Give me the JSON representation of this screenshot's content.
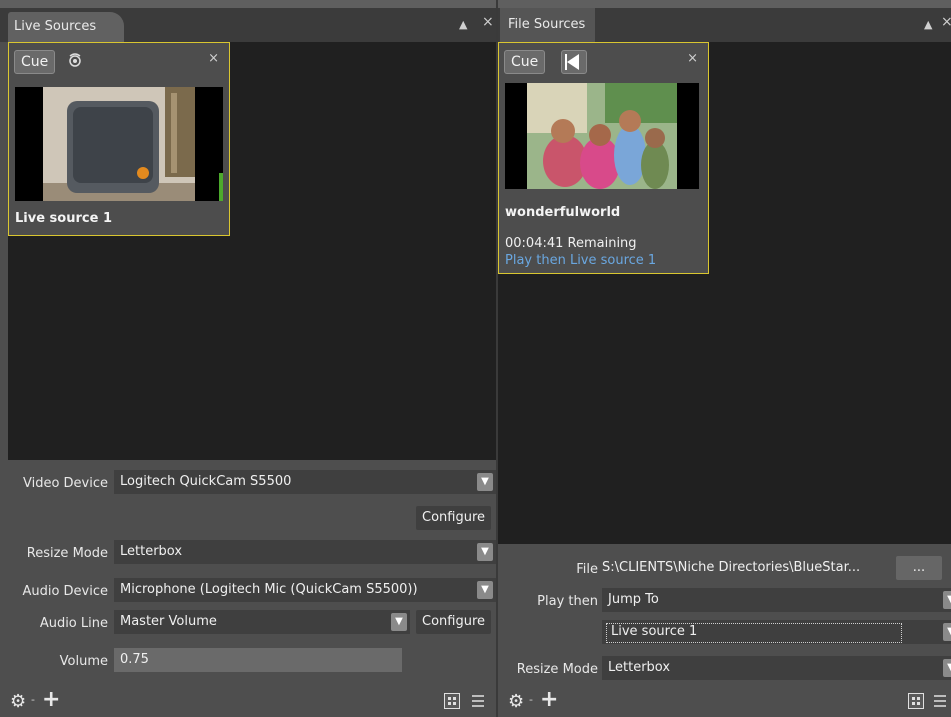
{
  "live_panel": {
    "tab_title": "Live Sources",
    "card": {
      "cue_label": "Cue",
      "close_glyph": "×",
      "title": "Live source 1"
    },
    "props": {
      "video_device": {
        "label": "Video Device",
        "value": "Logitech QuickCam S5500"
      },
      "configure_video_label": "Configure",
      "resize_mode": {
        "label": "Resize Mode",
        "value": "Letterbox"
      },
      "audio_device": {
        "label": "Audio Device",
        "value": "Microphone (Logitech Mic (QuickCam S5500))"
      },
      "audio_line": {
        "label": "Audio Line",
        "value": "Master Volume"
      },
      "configure_audio_label": "Configure",
      "volume": {
        "label": "Volume",
        "value": "0.75"
      }
    }
  },
  "file_panel": {
    "tab_title": "File Sources",
    "card": {
      "cue_label": "Cue",
      "close_glyph": "×",
      "title": "wonderfulworld",
      "remaining": "00:04:41 Remaining",
      "play_then_text": "Play then Live source 1"
    },
    "props": {
      "file": {
        "label": "File",
        "value": "S:\\CLIENTS\\Niche Directories\\BlueStar..."
      },
      "browse_label": "...",
      "play_then": {
        "label": "Play then",
        "value": "Jump To"
      },
      "target_value": "Live source 1",
      "resize_mode": {
        "label": "Resize Mode",
        "value": "Letterbox"
      }
    }
  },
  "icons": {
    "pin": "pin-icon",
    "close": "close-icon",
    "eye": "preview-icon",
    "gear": "gear-icon",
    "plus": "plus-icon",
    "grid_view": "grid-view-icon",
    "list_view": "list-view-icon",
    "dropdown": "chevron-down-icon"
  },
  "colors": {
    "card_border": "#d9c630",
    "link_blue": "#6aa7e0",
    "stage": "#202020"
  }
}
